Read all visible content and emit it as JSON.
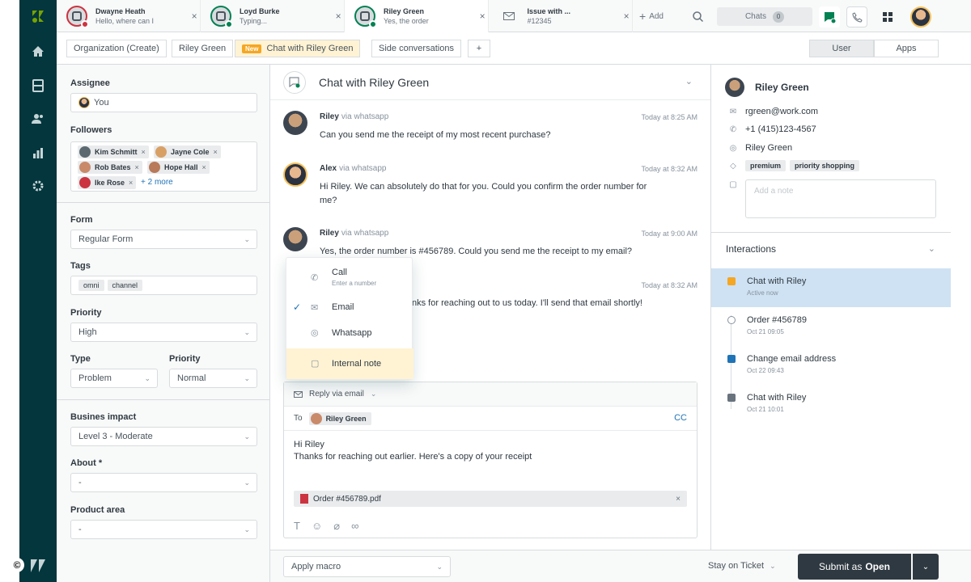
{
  "copyright_symbol": "©",
  "tabs": [
    {
      "name": "Dwayne Heath",
      "preview": "Hello, where can I",
      "status_color": "#cc3340"
    },
    {
      "name": "Loyd Burke",
      "preview": "Typing...",
      "status_color": "#038153"
    },
    {
      "name": "Riley Green",
      "preview": "Yes, the order",
      "status_color": "#038153"
    },
    {
      "name": "Issue with ...",
      "preview": "#12345",
      "status_color": ""
    }
  ],
  "topbar": {
    "add_label": "Add",
    "chats_label": "Chats",
    "chats_count": "0",
    "close_glyph": "×",
    "plus_glyph": "+"
  },
  "subbar": {
    "crumbs": [
      "Organization (Create)",
      "Riley Green",
      "Chat with Riley Green",
      "Side conversations"
    ],
    "new_badge": "New",
    "add_glyph": "+",
    "segments": [
      "User",
      "Apps"
    ]
  },
  "form": {
    "assignee_label": "Assignee",
    "assignee_value": "You",
    "followers_label": "Followers",
    "followers": [
      "Kim Schmitt",
      "Jayne Cole",
      "Rob Bates",
      "Hope Hall",
      "Ike Rose"
    ],
    "followers_more": "+ 2 more",
    "chip_close": "×",
    "form_label": "Form",
    "form_value": "Regular Form",
    "tags_label": "Tags",
    "tags": [
      "omni",
      "channel"
    ],
    "priority_label": "Priority",
    "priority_value": "High",
    "type_label": "Type",
    "type_value": "Problem",
    "priority2_label": "Priority",
    "priority2_value": "Normal",
    "impact_label": "Busines impact",
    "impact_value": "Level 3 - Moderate",
    "about_label": "About *",
    "about_value": "-",
    "product_label": "Product area",
    "product_value": "-"
  },
  "conversation": {
    "title": "Chat with Riley Green",
    "messages": [
      {
        "author": "Riley",
        "via": "via whatsapp",
        "time": "Today at 8:25 AM",
        "text": "Can you send me the receipt of my most recent purchase?"
      },
      {
        "author": "Alex",
        "via": "via whatsapp",
        "time": "Today at 8:32 AM",
        "text": "Hi Riley. We can absolutely do that for you. Could you confirm the order number for me?"
      },
      {
        "author": "Riley",
        "via": "via whatsapp",
        "time": "Today at 9:00 AM",
        "text": "Yes, the order number is #456789. Could you send me the receipt to my email?"
      },
      {
        "author": "",
        "via": "",
        "time": "Today at 8:32 AM",
        "text": "nks for reaching out to us today. I'll send that email shortly!"
      }
    ]
  },
  "channel_menu": {
    "items": [
      {
        "label": "Call",
        "sub": "Enter a number"
      },
      {
        "label": "Email",
        "sub": ""
      },
      {
        "label": "Whatsapp",
        "sub": ""
      },
      {
        "label": "Internal note",
        "sub": ""
      }
    ],
    "selected": "Email"
  },
  "composer": {
    "reply_label": "Reply via email",
    "to_label": "To",
    "to_recipient": "Riley Green",
    "cc_label": "CC",
    "body_line1": "Hi Riley",
    "body_line2": "Thanks for reaching out earlier. Here's a copy of your receipt",
    "attachment": "Order #456789.pdf",
    "attachment_close": "×"
  },
  "bottom": {
    "macro_placeholder": "Apply macro",
    "stay_label": "Stay on Ticket",
    "submit_prefix": "Submit as",
    "submit_status": "Open"
  },
  "user_panel": {
    "name": "Riley Green",
    "email": "rgreen@work.com",
    "phone": "+1 (415)123-4567",
    "whatsapp": "Riley Green",
    "tags": [
      "premium",
      "priority shopping"
    ],
    "note_placeholder": "Add a note"
  },
  "interactions": {
    "title": "Interactions",
    "items": [
      {
        "label": "Chat with Riley",
        "sub": "Active now",
        "color": "#f5a623"
      },
      {
        "label": "Order #456789",
        "sub": "Oct 21 09:05",
        "color": ""
      },
      {
        "label": "Change email address",
        "sub": "Oct 22 09:43",
        "color": "#1f73b7"
      },
      {
        "label": "Chat with Riley",
        "sub": "Oct 21 10:01",
        "color": "#68737d"
      }
    ]
  },
  "colors": {
    "nav_bg": "#03363d",
    "accent_blue": "#1f73b7",
    "active_green": "#038153",
    "highlight_yellow": "#fff3d4",
    "selected_blue": "#cfe2f3",
    "submit_bg": "#2f3941"
  }
}
